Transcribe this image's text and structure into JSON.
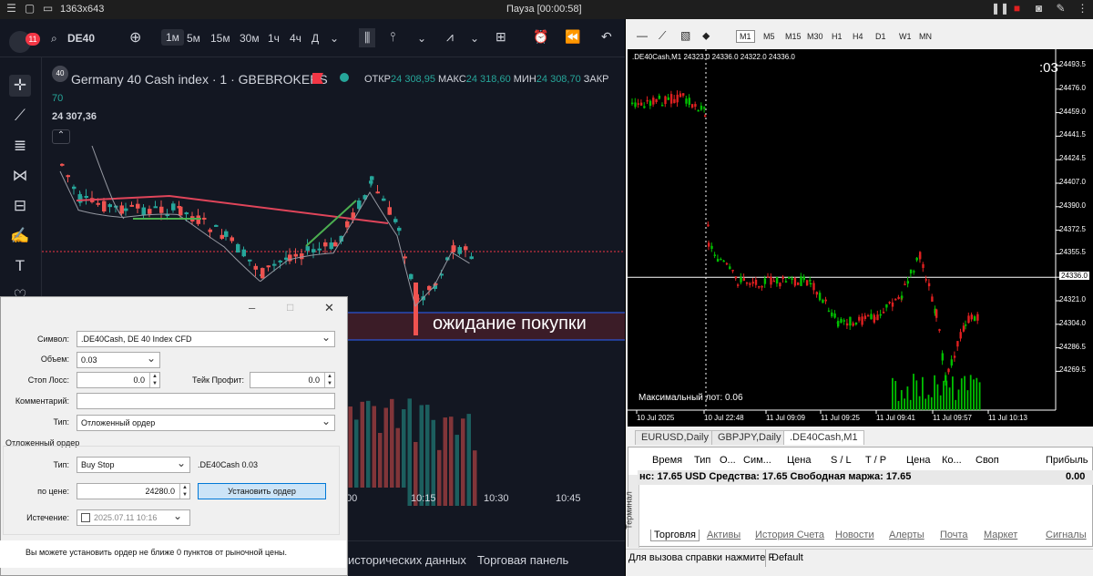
{
  "recorder": {
    "resolution": "1363x643",
    "status": "Пауза [00:00:58]"
  },
  "left_app": {
    "notifications_badge": "11",
    "symbol": "DE40",
    "timeframes": [
      "1м",
      "5м",
      "15м",
      "30м",
      "1ч",
      "4ч",
      "Д"
    ],
    "active_timeframe": "1м",
    "chart_title": "Germany 40 Cash index · 1 · GBEBROKERS",
    "ohlc": {
      "open_label": "ОТКР",
      "open": "24 308,95",
      "high_label": "МАКС",
      "high": "24 318,60",
      "low_label": "МИН",
      "low": "24 308,70",
      "close_label": "ЗАКР"
    },
    "indicator_value": "70",
    "price_value": "24 307,36",
    "annotation": "ожидание покупки",
    "time_labels": [
      "00",
      "10:15",
      "10:30",
      "10:45"
    ],
    "bottom_tabs": [
      "исторических данных",
      "Торговая панель"
    ],
    "colors": {
      "bg": "#131722",
      "up": "#26a69a",
      "down": "#ef5350",
      "trendline": "#e0455a",
      "green_line": "#4caf50"
    }
  },
  "right_app": {
    "timeframes": [
      "M1",
      "M5",
      "M15",
      "M30",
      "H1",
      "H4",
      "D1",
      "W1",
      "MN"
    ],
    "active_timeframe": "M1",
    "chart_header": ".DE40Cash,M1  24323.0 24336.0 24322.0 24336.0",
    "countdown": ":03",
    "max_lot": "Максимальный лот: 0.06",
    "price_ticks": [
      "24493.5",
      "24476.0",
      "24459.0",
      "24441.5",
      "24424.5",
      "24407.0",
      "24390.0",
      "24372.5",
      "24355.5",
      "24336.0",
      "24321.0",
      "24304.0",
      "24286.5",
      "24269.5"
    ],
    "current_price": "24336.0",
    "time_ticks": [
      "10 Jul 2025",
      "10 Jul 22:48",
      "11 Jul 09:09",
      "11 Jul 09:25",
      "11 Jul 09:41",
      "11 Jul 09:57",
      "11 Jul 10:13"
    ],
    "chart_tabs": [
      "EURUSD,Daily",
      "GBPJPY,Daily",
      ".DE40Cash,M1"
    ],
    "active_chart_tab": ".DE40Cash,M1",
    "terminal_columns": [
      "Время",
      "Тип",
      "О...",
      "Сим...",
      "Цена",
      "S / L",
      "T / P",
      "Цена",
      "Ко...",
      "Своп",
      "Прибыль"
    ],
    "balance_line": "нс: 17.65 USD  Средства: 17.65  Свободная маржа: 17.65",
    "balance_profit": "0.00",
    "terminal_side_label": "Терминал",
    "terminal_tabs": [
      "Торговля",
      "Активы",
      "История Счета",
      "Новости",
      "Алерты",
      "Почта",
      "Маркет",
      "Сигналы"
    ],
    "status_help": "Для вызова справки нажмите F",
    "status_profile": "Default"
  },
  "order_dialog": {
    "symbol_label": "Символ:",
    "symbol_value": ".DE40Cash, DE 40 Index CFD",
    "volume_label": "Объем:",
    "volume_value": "0.03",
    "sl_label": "Стоп Лосс:",
    "sl_value": "0.0",
    "tp_label": "Тейк Профит:",
    "tp_value": "0.0",
    "comment_label": "Комментарий:",
    "comment_value": "",
    "type_label": "Тип:",
    "type_value": "Отложенный ордер",
    "pending_group": "Отложенный ордер",
    "pending_type_label": "Тип:",
    "pending_type_value": "Buy Stop",
    "pending_symbol_info": ".DE40Cash 0.03",
    "price_label": "по цене:",
    "price_value": "24280.0",
    "set_button": "Установить ордер",
    "expiry_label": "Истечение:",
    "expiry_value": "2025.07.11 10:16",
    "message": "Вы можете установить ордер не ближе 0 пунктов от рыночной цены."
  }
}
